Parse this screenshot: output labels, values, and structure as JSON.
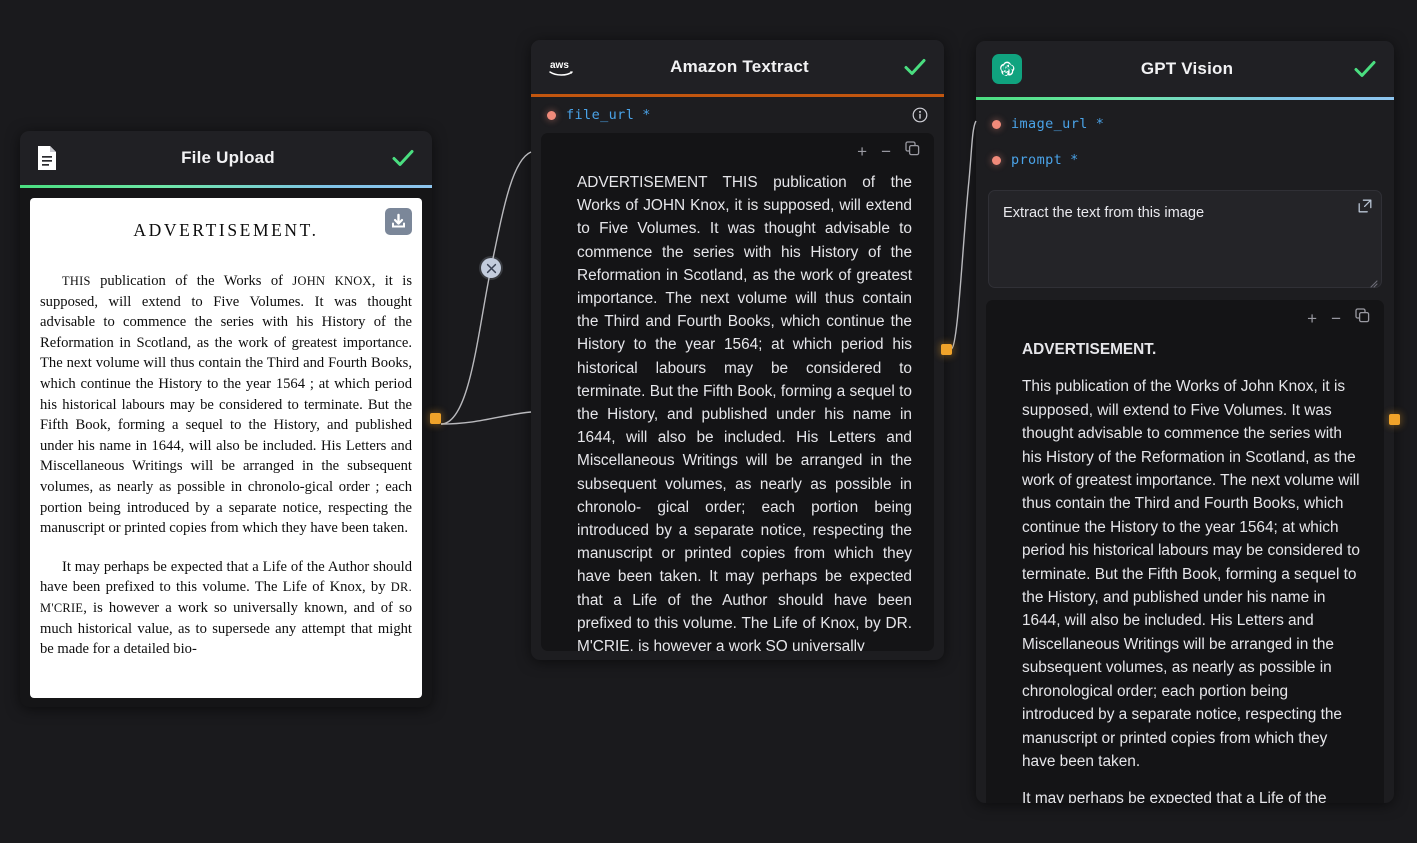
{
  "canvas": {
    "background": "#1a1a1d"
  },
  "nodes": {
    "file_upload": {
      "title": "File Upload",
      "icon": "document-file-icon",
      "status": "check-icon",
      "accent": "#4ade80",
      "download_button": "download-icon",
      "document": {
        "heading": "ADVERTISEMENT.",
        "paragraphs": [
          "THIS publication of the Works of JOHN KNOX, it is supposed, will extend to Five Volumes. It was thought advisable to commence the series with his History of the Reformation in Scotland, as the work of greatest importance. The next volume will thus contain the Third and Fourth Books, which continue the History to the year 1564 ; at which period his historical labours may be considered to terminate. But the Fifth Book, forming a sequel to the History, and published under his name in 1644, will also be included. His Letters and Miscellaneous Writings will be arranged in the subsequent volumes, as nearly as possible in chronolo-gical order ; each portion being introduced by a separate notice, respecting the manuscript or printed copies from which they have been taken.",
          "It may perhaps be expected that a Life of the Author should have been prefixed to this volume. The Life of Knox, by DR. M'CRIE, is however a work so universally known, and of so much historical value, as to supersede any attempt that might be made for a detailed bio-"
        ]
      }
    },
    "textract": {
      "title": "Amazon Textract",
      "icon": "aws-logo-icon",
      "status": "check-icon",
      "accent": "#c2560f",
      "ports": [
        {
          "name": "file_url",
          "required": "*",
          "info": "info-icon"
        }
      ],
      "toolbar": {
        "zoom_in": "+",
        "zoom_out": "−",
        "copy": "copy-icon"
      },
      "output": "ADVERTISEMENT THIS publication of the Works of JOHN Knox, it is supposed, will extend to Five Volumes. It was thought advisable to commence the series with his History of the Reformation in Scotland, as the work of greatest importance. The next volume will thus contain the Third and Fourth Books, which continue the History to the year 1564; at which period his historical labours may be considered to terminate. But the Fifth Book, forming a sequel to the History, and published under his name in 1644, will also be included. His Letters and Miscellaneous Writings will be arranged in the subsequent volumes, as nearly as possible in chronolo- gical order; each portion being introduced by a separate notice, respecting the manuscript or printed copies from which they have been taken. It may perhaps be expected that a Life of the Author should have been prefixed to this volume. The Life of Knox, by DR. M'CRIE, is however a work SO universally"
    },
    "gpt_vision": {
      "title": "GPT Vision",
      "icon": "openai-logo-icon",
      "status": "check-icon",
      "accent": "#4ade80",
      "ports": [
        {
          "name": "image_url",
          "required": "*"
        },
        {
          "name": "prompt",
          "required": "*"
        }
      ],
      "prompt_field": {
        "value": "Extract the text from this image",
        "placeholder": "Extract the text from this image",
        "expand": "expand-icon"
      },
      "toolbar": {
        "zoom_in": "+",
        "zoom_out": "−",
        "copy": "copy-icon"
      },
      "output": {
        "heading": "ADVERTISEMENT.",
        "paragraphs": [
          "This publication of the Works of John Knox, it is supposed, will extend to Five Volumes. It was thought advisable to commence the series with his History of the Reformation in Scotland, as the work of greatest importance. The next volume will thus contain the Third and Fourth Books, which continue the History to the year 1564; at which period his historical labours may be considered to terminate. But the Fifth Book, forming a sequel to the History, and published under his name in 1644, will also be included. His Letters and Miscellaneous Writings will be arranged in the subsequent volumes, as nearly as possible in chronological order; each portion being introduced by a separate notice, respecting the manuscript or printed copies from which they have been taken.",
          "It may perhaps be expected that a Life of the Author should have been prefixed to this"
        ]
      }
    }
  },
  "edges": {
    "delete_button": "×",
    "handle_color": "#f0a32a"
  }
}
